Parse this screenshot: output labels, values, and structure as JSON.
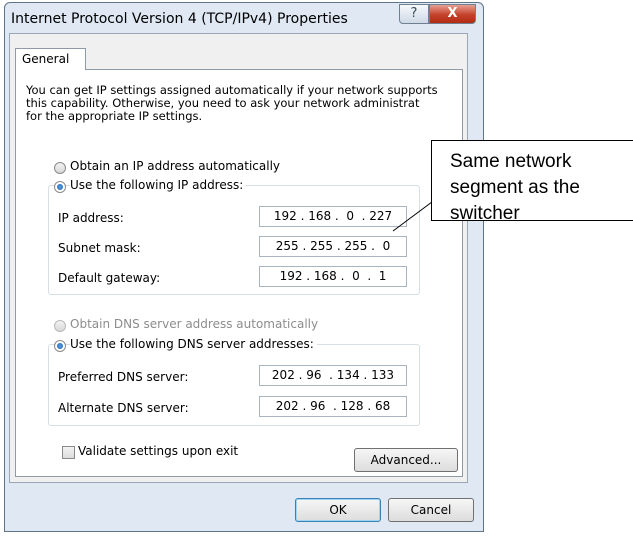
{
  "dialog": {
    "title": "Internet Protocol Version 4 (TCP/IPv4) Properties",
    "help_glyph": "?",
    "close_glyph": "X",
    "tab_label": "General",
    "description_lines": [
      "You can get IP settings assigned automatically if your network supports",
      "this capability. Otherwise, you need to ask your network administrat",
      "for the appropriate IP settings."
    ],
    "ip": {
      "auto_option": "Obtain an IP address automatically",
      "manual_option": "Use the following IP address:",
      "selected": "manual",
      "fields": [
        {
          "label": "IP address:",
          "value": "192 . 168 .  0  . 227"
        },
        {
          "label": "Subnet mask:",
          "value": "255 . 255 . 255 .  0"
        },
        {
          "label": "Default gateway:",
          "value": "192 . 168 .  0  .  1"
        }
      ]
    },
    "dns": {
      "auto_option": "Obtain DNS server address automatically",
      "manual_option": "Use the following DNS server addresses:",
      "selected": "manual",
      "fields": [
        {
          "label": "Preferred DNS server:",
          "value": "202 . 96  . 134 . 133"
        },
        {
          "label": "Alternate DNS server:",
          "value": "202 . 96  . 128 . 68"
        }
      ]
    },
    "validate_label": "Validate settings upon exit",
    "validate_checked": false,
    "advanced_label": "Advanced...",
    "ok_label": "OK",
    "cancel_label": "Cancel"
  },
  "annotation": {
    "lines": [
      "Same network",
      "segment as the",
      "switcher"
    ]
  },
  "icons": {
    "help": "help-icon",
    "close": "close-icon"
  }
}
